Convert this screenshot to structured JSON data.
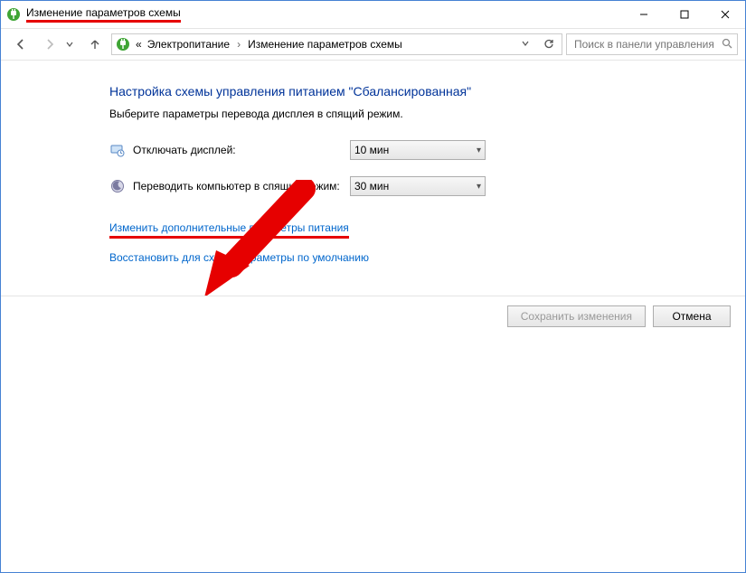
{
  "window": {
    "title": "Изменение параметров схемы"
  },
  "nav": {
    "crumb_prefix": "«",
    "crumb1": "Электропитание",
    "crumb2": "Изменение параметров схемы",
    "search_placeholder": "Поиск в панели управления"
  },
  "page": {
    "heading": "Настройка схемы управления питанием \"Сбалансированная\"",
    "subtext": "Выберите параметры перевода дисплея в спящий режим."
  },
  "settings": {
    "display_off": {
      "label": "Отключать дисплей:",
      "value": "10 мин"
    },
    "sleep": {
      "label": "Переводить компьютер в спящий режим:",
      "value": "30 мин"
    }
  },
  "links": {
    "advanced": "Изменить дополнительные параметры питания",
    "restore": "Восстановить для схемы параметры по умолчанию"
  },
  "buttons": {
    "save": "Сохранить изменения",
    "cancel": "Отмена"
  }
}
